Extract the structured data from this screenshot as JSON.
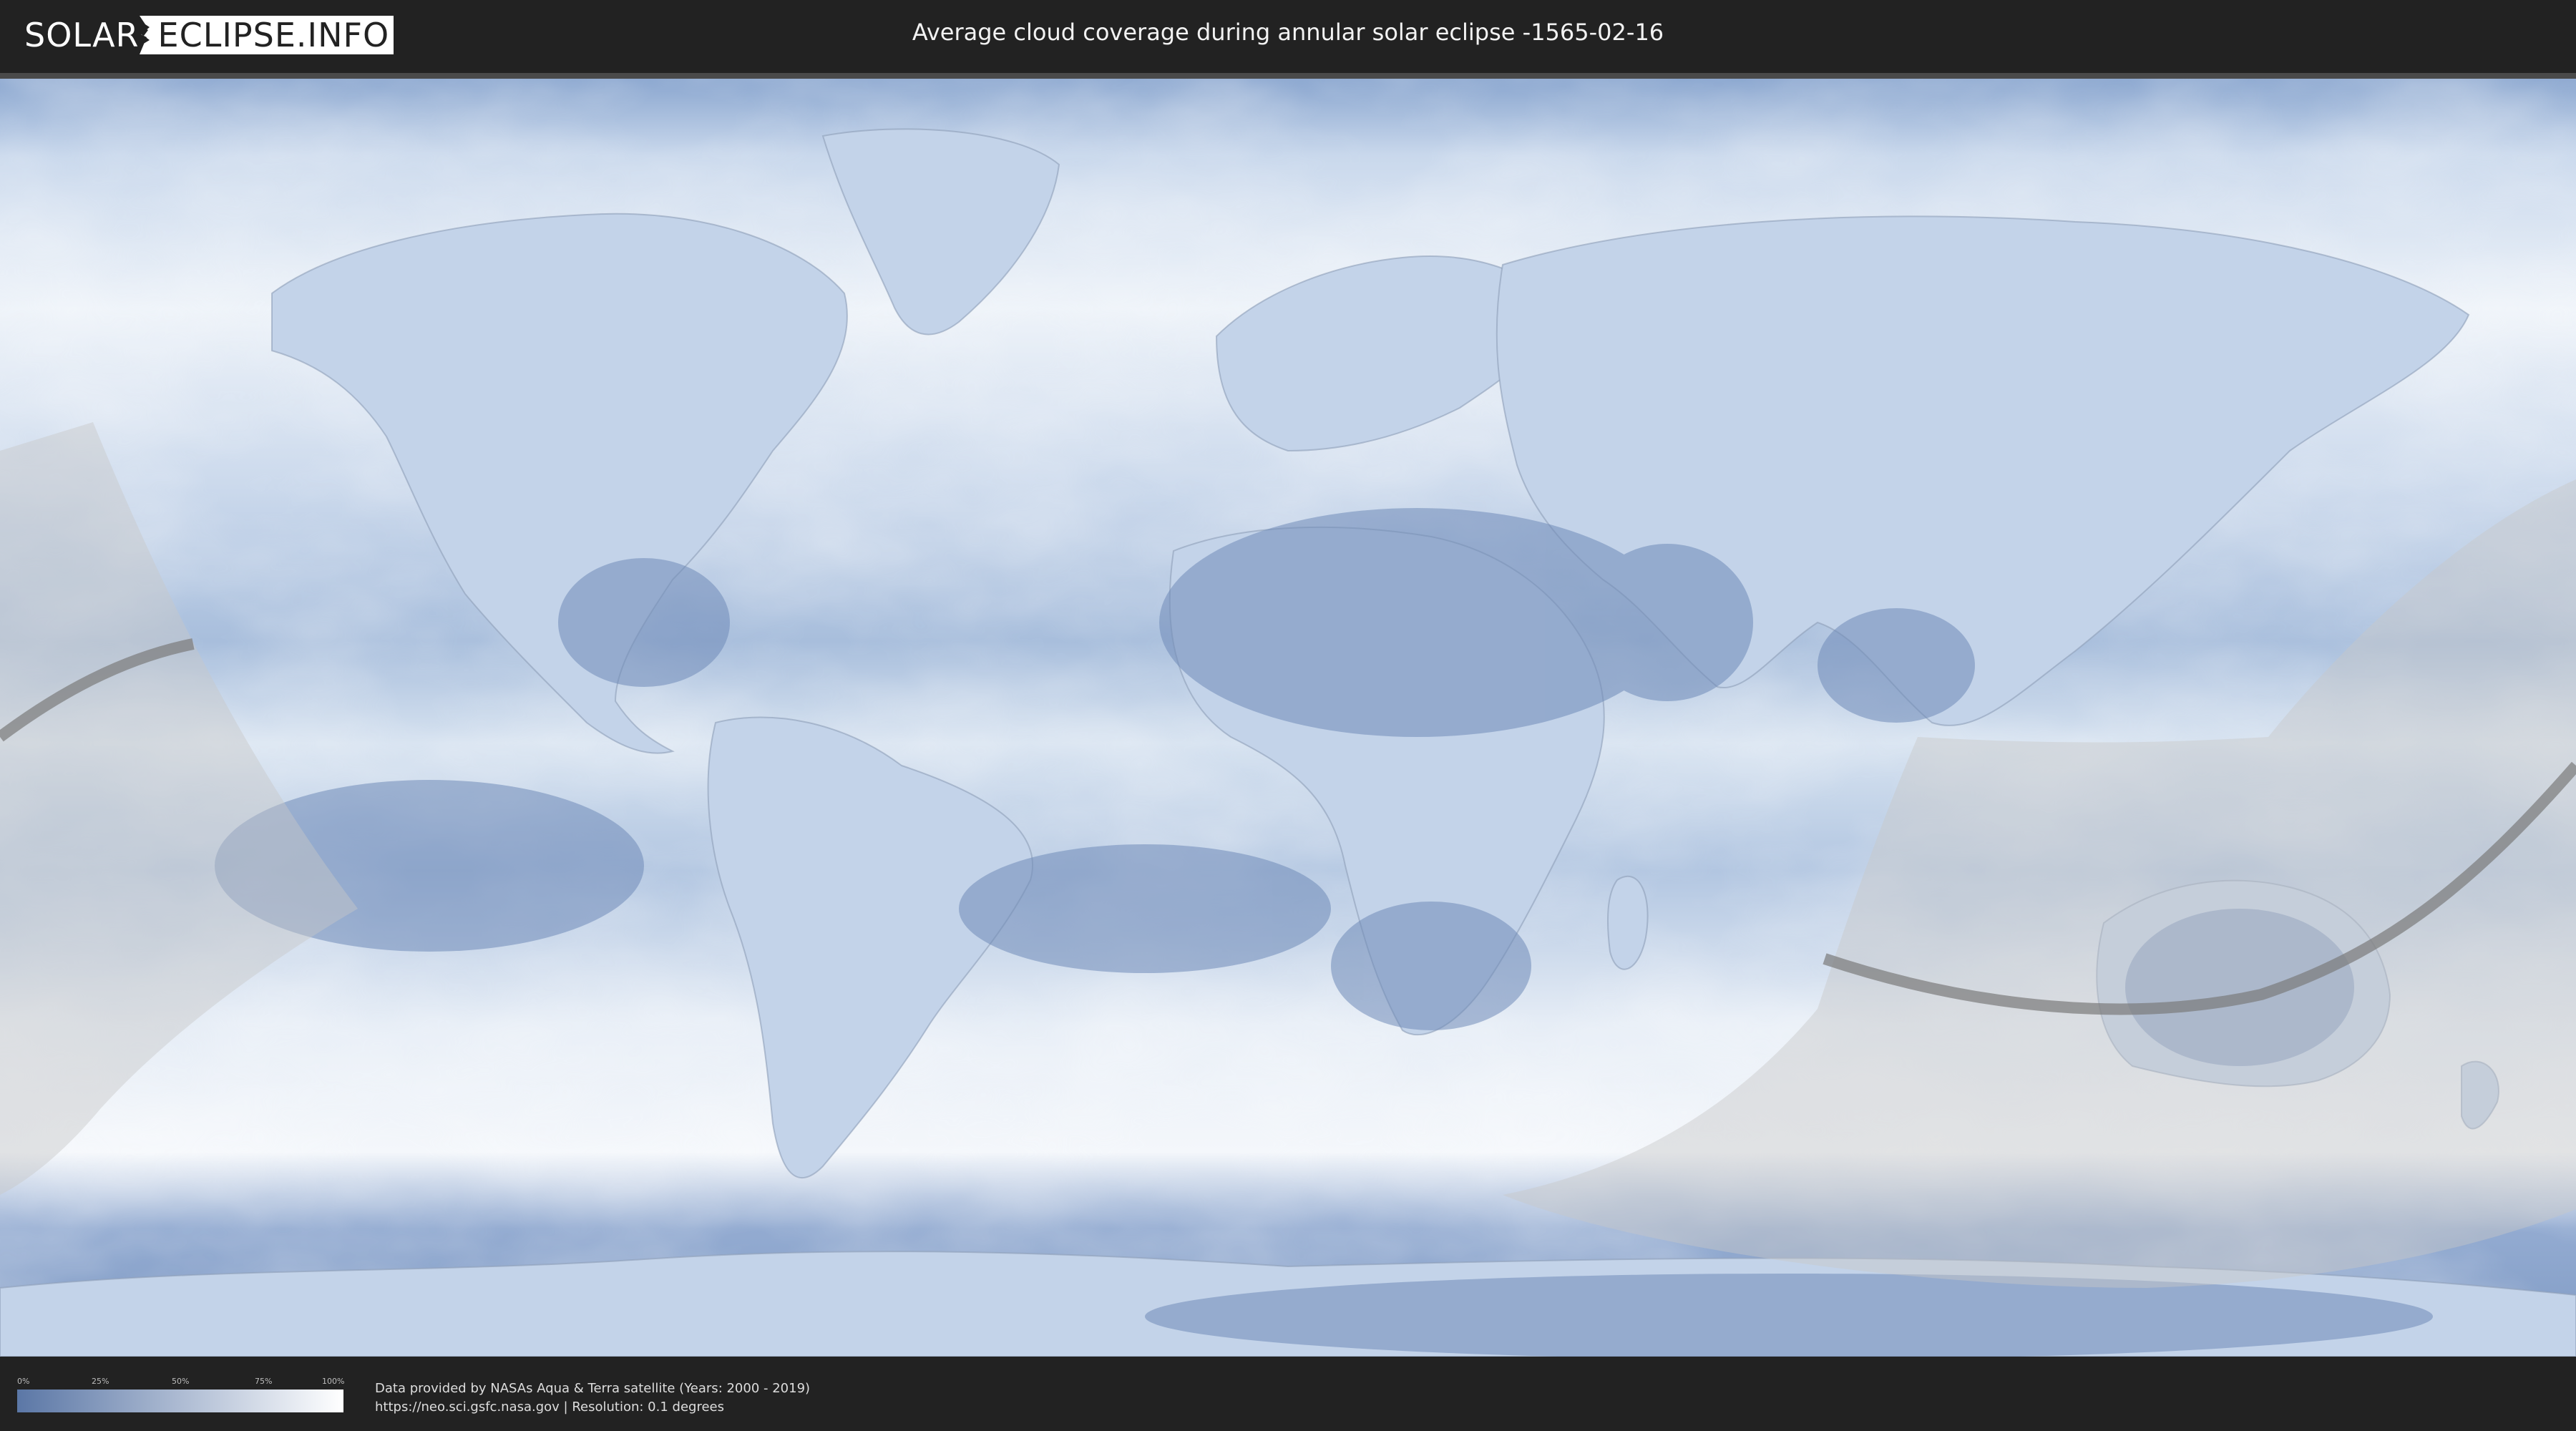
{
  "header": {
    "logo_left": "SOLAR",
    "logo_right": "ECLIPSE.INFO",
    "title": "Average cloud coverage during annular solar eclipse -1565-02-16"
  },
  "legend": {
    "ticks": [
      "0%",
      "25%",
      "50%",
      "75%",
      "100%"
    ],
    "color_low": "#5b77a6",
    "color_high": "#ffffff"
  },
  "credits": {
    "line1": "Data provided by NASAs Aqua & Terra satellite (Years: 2000 - 2019)",
    "line2": "https://neo.sci.gsfc.nasa.gov | Resolution: 0.1 degrees"
  },
  "colors": {
    "background": "#222222",
    "ocean_cloud": "#b8cbe4",
    "clear_sky": "#6f8bb8",
    "overcast": "#f4f7fb",
    "eclipse_zone": "#c8c8c8",
    "central_path": "#7a7a7a"
  }
}
